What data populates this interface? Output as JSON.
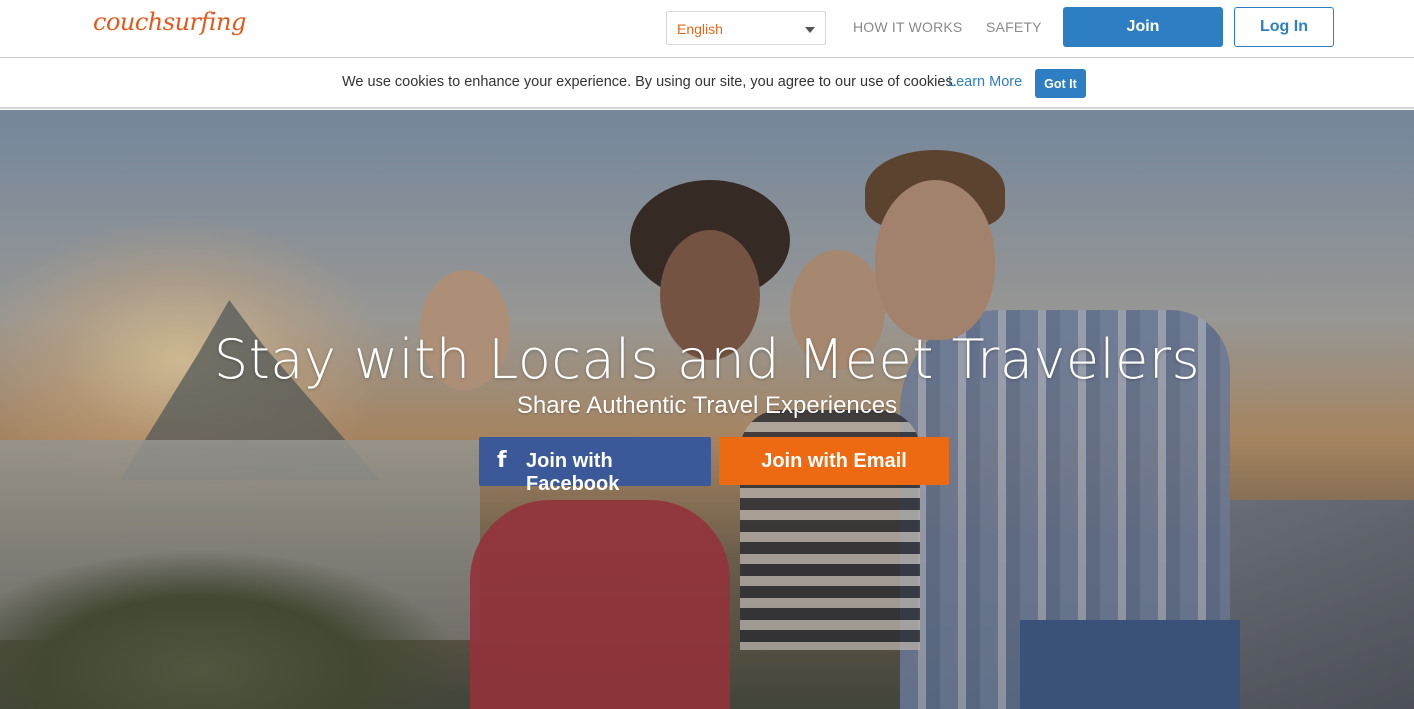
{
  "header": {
    "logo": "couchsurfing",
    "language": "English",
    "nav": {
      "how_it_works": "HOW IT WORKS",
      "safety": "SAFETY"
    },
    "join_label": "Join",
    "login_label": "Log In"
  },
  "cookie_bar": {
    "message": "We use cookies to enhance your experience. By using our site, you agree to our use of cookies.",
    "learn_more": "Learn More",
    "got_it": "Got It"
  },
  "hero": {
    "title": "Stay with Locals and Meet Travelers",
    "subtitle": "Share Authentic Travel Experiences",
    "facebook_icon": "f",
    "facebook_button": "Join with Facebook",
    "email_button": "Join with Email"
  },
  "colors": {
    "brand_orange": "#e4581a",
    "primary_blue": "#2d7ec2",
    "facebook_blue": "#3b5998",
    "email_orange": "#ee6a12"
  }
}
